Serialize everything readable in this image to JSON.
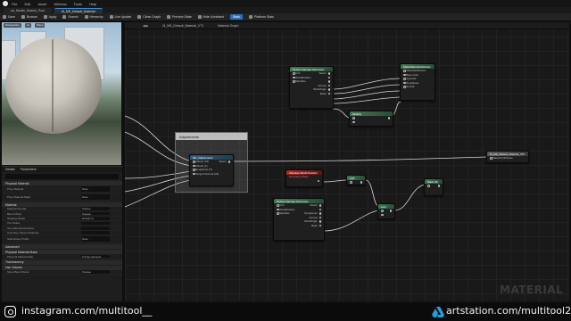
{
  "menu": {
    "items": [
      "File",
      "Edit",
      "Asset",
      "Window",
      "Tools",
      "Help"
    ]
  },
  "tabs": [
    {
      "label": "ue_Nordic_Search_Pool"
    },
    {
      "label": "M_MS_Default_Material"
    }
  ],
  "toolbar": {
    "items": [
      "Save",
      "Browse",
      "Apply",
      "Search",
      "Hierarchy",
      "Live Update",
      "Clean Graph",
      "Preview State",
      "Hide Unrelated",
      "Stats",
      "Platform Stats"
    ],
    "highlighted": "Stats"
  },
  "viewport": {
    "chips": [
      "Perspective",
      "Lit",
      "Show"
    ]
  },
  "details": {
    "tabs": [
      "Details",
      "Parameters"
    ],
    "sections": [
      {
        "title": "Physical Material",
        "rows": [
          {
            "label": "Phys Material",
            "value": "None",
            "tall": true
          },
          {
            "label": "Phys Material Mask",
            "value": "None",
            "tall": true
          }
        ]
      },
      {
        "title": "Material",
        "rows": [
          {
            "label": "Material Domain",
            "value": "Surface"
          },
          {
            "label": "Blend Mode",
            "value": "Opaque"
          },
          {
            "label": "Shading Model",
            "value": "Default Lit"
          },
          {
            "label": "Two Sided",
            "value": ""
          },
          {
            "label": "Use Material Attributes",
            "value": ""
          },
          {
            "label": "Cast Ray Traced Shadows",
            "value": ""
          },
          {
            "label": "Subsurface Profile",
            "value": "None",
            "tall": true
          }
        ]
      },
      {
        "title": "Advanced",
        "rows": []
      },
      {
        "title": "Physical Material Mask",
        "rows": [
          {
            "label": "Physical Material Map",
            "value": "0 Array elements"
          }
        ]
      },
      {
        "title": "Translucency",
        "rows": []
      },
      {
        "title": "Use Volume",
        "rows": [
          {
            "label": "Show Blend Mode",
            "value": "Opaque"
          }
        ]
      }
    ]
  },
  "graph": {
    "tab_label": "M_MS_Default_Material_VT1",
    "breadcrumb": "Material Graph",
    "watermark": "MATERIAL",
    "comment_title": "Adjustments",
    "nodes": {
      "texture_sample_1": {
        "title": "Texture Sample Parameter",
        "pins": [
          "UVs",
          "WorldPosition",
          "MipValue",
          "Normal",
          "WorldAngle",
          "Rough",
          "Mask"
        ]
      },
      "make_attributes": {
        "title": "MakeMaterialAttributes",
        "pins": [
          "MaterialAttributes",
          "Base Color",
          "Specular",
          "Roughness",
          "Normal"
        ]
      },
      "small_node": {
        "title": "Multiply"
      },
      "ms_adjust": {
        "title": "MF_Adjustments",
        "pins": [
          "Albedo (V3)",
          "Albedo (V)",
          "Roughness (V)",
          "Tangent Normal (V3)",
          "Result"
        ]
      },
      "output": {
        "title": "M_MS_Default_Material_VT1",
        "pins": [
          "Material Attributes"
        ]
      },
      "red_node": {
        "title": "Absolute World Position",
        "subtitle": "Excluding Offsets"
      },
      "small_gray": {
        "title": "Add"
      },
      "texture_sample_2": {
        "title": "Texture Sample Parameter",
        "pins": [
          "UVs",
          "WorldPosition",
          "MipValue",
          "Roughness",
          "Normal",
          "WorldAngle",
          "Rough",
          "Mask"
        ]
      },
      "lerp": {
        "title": "Lerp"
      },
      "mask_node": {
        "title": "Mask (R)"
      }
    }
  },
  "footer": {
    "instagram": "instagram.com/multitool__",
    "artstation": "artstation.com/multitool2"
  }
}
